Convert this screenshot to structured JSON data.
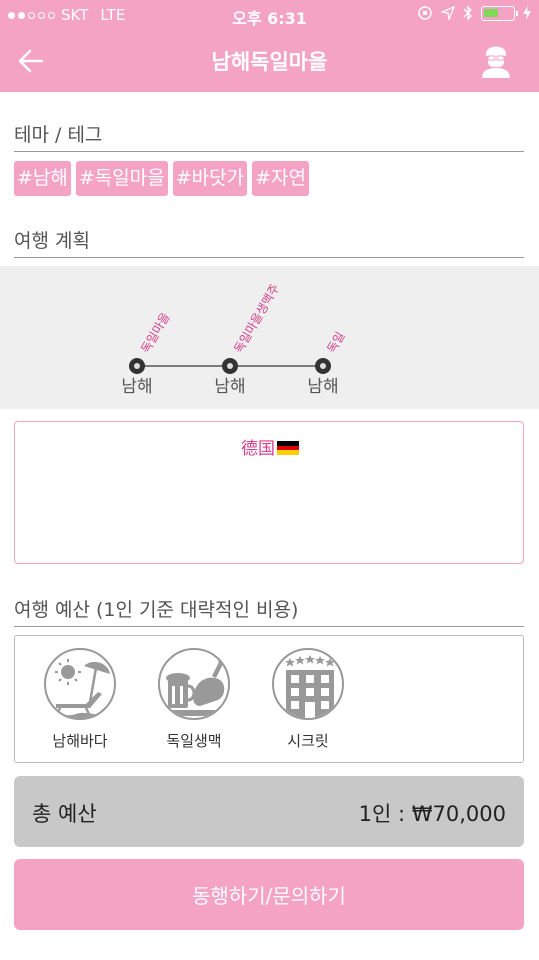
{
  "status_bar": {
    "carrier": "SKT",
    "network": "LTE",
    "time": "오후 6:31"
  },
  "nav": {
    "title": "남해독일마을",
    "back_icon": "back-arrow-icon",
    "profile_icon": "user-avatar-icon"
  },
  "theme": {
    "heading": "테마 / 테그",
    "tags": [
      "#남해",
      "#독일마을",
      "#바닷가",
      "#자연"
    ]
  },
  "plan": {
    "heading": "여행 계획",
    "stops": [
      {
        "name": "독일마을",
        "region": "남해"
      },
      {
        "name": "독일마을생맥주",
        "region": "남해"
      },
      {
        "name": "독일",
        "region": "남해"
      }
    ]
  },
  "note": {
    "text": "德国",
    "flag_icon": "germany-flag-icon"
  },
  "budget": {
    "heading": "여행 예산 (1인 기준 대략적인 비용)",
    "items": [
      {
        "label": "남해바다",
        "icon": "beach-icon"
      },
      {
        "label": "독일생맥",
        "icon": "beer-chicken-icon"
      },
      {
        "label": "시크릿",
        "icon": "hotel-icon"
      }
    ]
  },
  "total": {
    "label": "총 예산",
    "value": "1인 : ₩70,000"
  },
  "cta": {
    "label": "동행하기/문의하기"
  },
  "colors": {
    "accent": "#f4a3c4",
    "accent_text": "#d6408c",
    "total_bg": "#c8c8c8"
  }
}
